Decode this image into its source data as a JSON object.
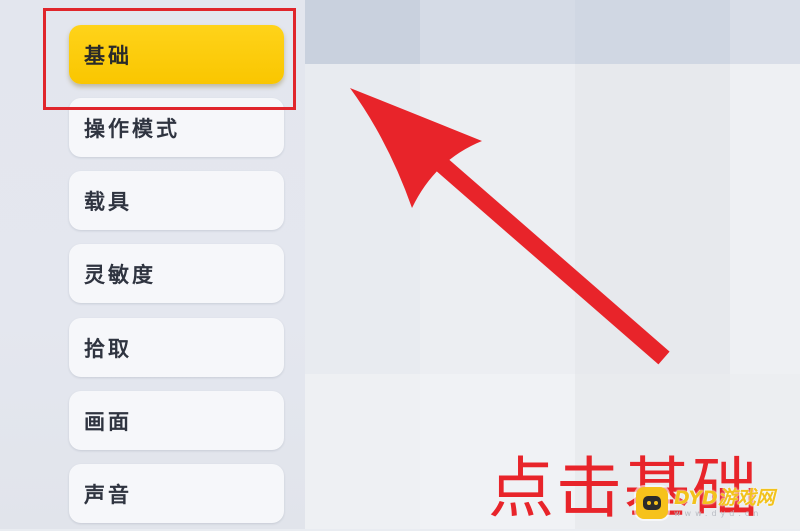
{
  "menu": {
    "items": [
      {
        "label": "基础",
        "active": true
      },
      {
        "label": "操作模式",
        "active": false
      },
      {
        "label": "载具",
        "active": false
      },
      {
        "label": "灵敏度",
        "active": false
      },
      {
        "label": "拾取",
        "active": false
      },
      {
        "label": "画面",
        "active": false
      },
      {
        "label": "声音",
        "active": false
      }
    ]
  },
  "annotation": {
    "caption": "点击基础",
    "color": "#e8242a"
  },
  "watermark": {
    "main": "DYD游戏网",
    "sub": "www.dyd.cn"
  },
  "colors": {
    "accent": "#f9c600",
    "highlight_border": "#e0252b"
  }
}
